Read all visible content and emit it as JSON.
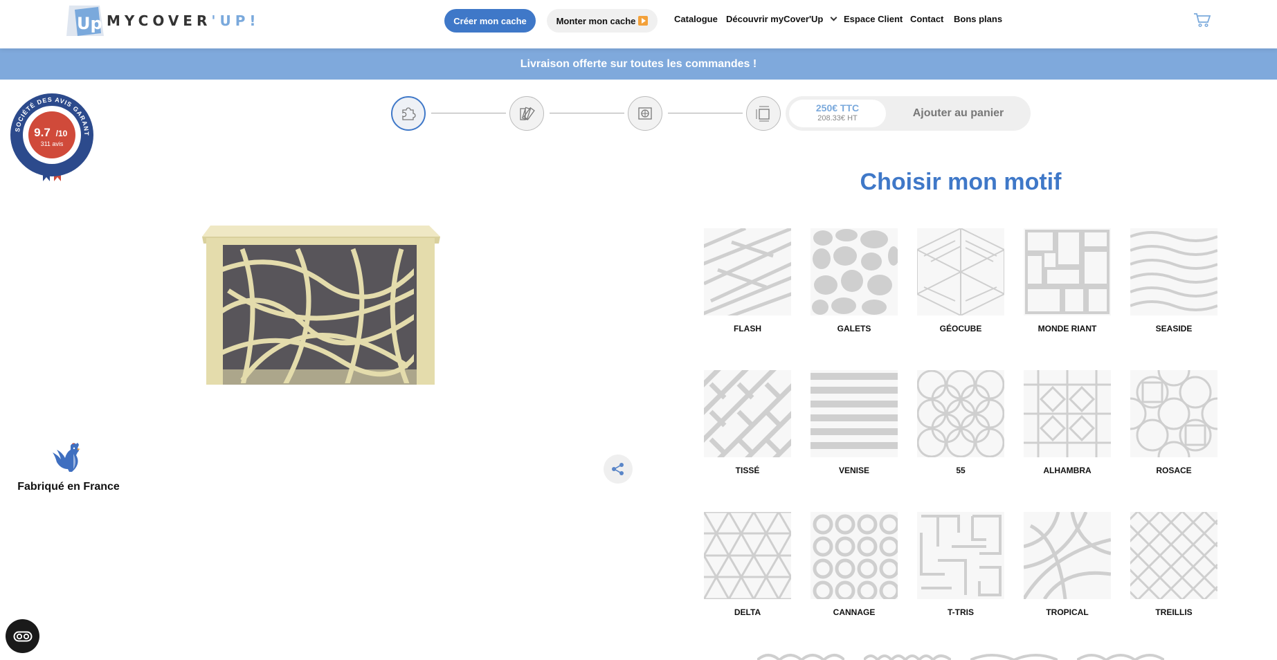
{
  "header": {
    "brand_light": "MY",
    "brand_dark": "COVER",
    "brand_accent": "'UP!",
    "cta_primary": "Créer mon cache",
    "cta_secondary": "Monter mon cache",
    "nav": [
      {
        "label": "Catalogue"
      },
      {
        "label": "Découvrir myCover'Up"
      },
      {
        "label": "Espace Client"
      },
      {
        "label": "Contact"
      },
      {
        "label": "Bons plans"
      }
    ]
  },
  "banner": {
    "text": "Livraison offerte sur toutes les commandes !"
  },
  "rating": {
    "score": "9.7",
    "max": "/10",
    "count": "311 avis",
    "ring_text": "SOCIÉTÉ DES AVIS GARANTIS"
  },
  "configurator": {
    "steps": [
      {
        "icon": "puzzle-icon",
        "active": true
      },
      {
        "icon": "swatches-icon",
        "active": false
      },
      {
        "icon": "unit-icon",
        "active": false
      },
      {
        "icon": "dimensions-icon",
        "active": false
      }
    ],
    "price_ttc": "250€ TTC",
    "price_ht": "208.33€ HT",
    "add_to_cart": "Ajouter au panier"
  },
  "made_in": {
    "label": "Fabriqué en France"
  },
  "pattern_section": {
    "title": "Choisir mon motif",
    "patterns": [
      {
        "name": "FLASH"
      },
      {
        "name": "GALETS"
      },
      {
        "name": "GÉOCUBE"
      },
      {
        "name": "MONDE RIANT"
      },
      {
        "name": "SEASIDE"
      },
      {
        "name": "TISSÉ"
      },
      {
        "name": "VENISE"
      },
      {
        "name": "55"
      },
      {
        "name": "ALHAMBRA"
      },
      {
        "name": "ROSACE"
      },
      {
        "name": "DELTA"
      },
      {
        "name": "CANNAGE"
      },
      {
        "name": "T-TRIS"
      },
      {
        "name": "TROPICAL"
      },
      {
        "name": "TREILLIS"
      }
    ]
  },
  "colors": {
    "accent": "#3f78c8",
    "banner": "#7fa9dc",
    "product": "#e6dfb0"
  }
}
